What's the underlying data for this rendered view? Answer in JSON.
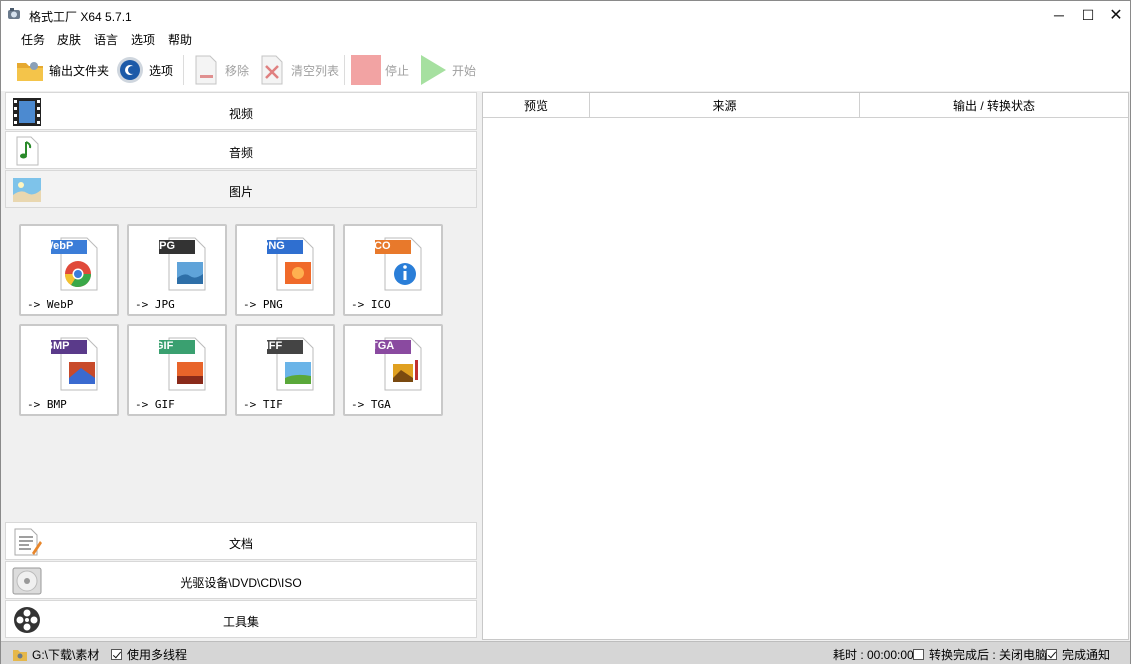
{
  "window": {
    "title": "格式工厂 X64 5.7.1",
    "min_glyph": "─",
    "max_glyph": "☐",
    "close_glyph": "✕"
  },
  "menu": [
    "任务",
    "皮肤",
    "语言",
    "选项",
    "帮助"
  ],
  "toolbar": {
    "output_folder": "输出文件夹",
    "options": "选项",
    "remove": "移除",
    "clear_list": "清空列表",
    "stop": "停止",
    "start": "开始"
  },
  "categories": {
    "video": "视频",
    "audio": "音频",
    "image": "图片",
    "document": "文档",
    "disc": "光驱设备\\DVD\\CD\\ISO",
    "tools": "工具集"
  },
  "formats": [
    {
      "badge": "WebP",
      "label": "-> WebP",
      "color": "#3b7dd8"
    },
    {
      "badge": "JPG",
      "label": "-> JPG",
      "color": "#333333"
    },
    {
      "badge": "PNG",
      "label": "-> PNG",
      "color": "#2f6fd0"
    },
    {
      "badge": "ICO",
      "label": "-> ICO",
      "color": "#e8792b"
    },
    {
      "badge": "BMP",
      "label": "-> BMP",
      "color": "#5a3a8a"
    },
    {
      "badge": "GIF",
      "label": "-> GIF",
      "color": "#3aa070"
    },
    {
      "badge": "TIFF",
      "label": "-> TIF",
      "color": "#444444"
    },
    {
      "badge": "TGA",
      "label": "-> TGA",
      "color": "#8a4aa0"
    }
  ],
  "task_table": {
    "columns": [
      "预览",
      "来源",
      "输出 / 转换状态"
    ]
  },
  "statusbar": {
    "output_path": "G:\\下载\\素材",
    "multithread": "使用多线程",
    "elapsed": "耗时 : 00:00:00",
    "shutdown": "转换完成后 : 关闭电脑",
    "notify": "完成通知"
  }
}
